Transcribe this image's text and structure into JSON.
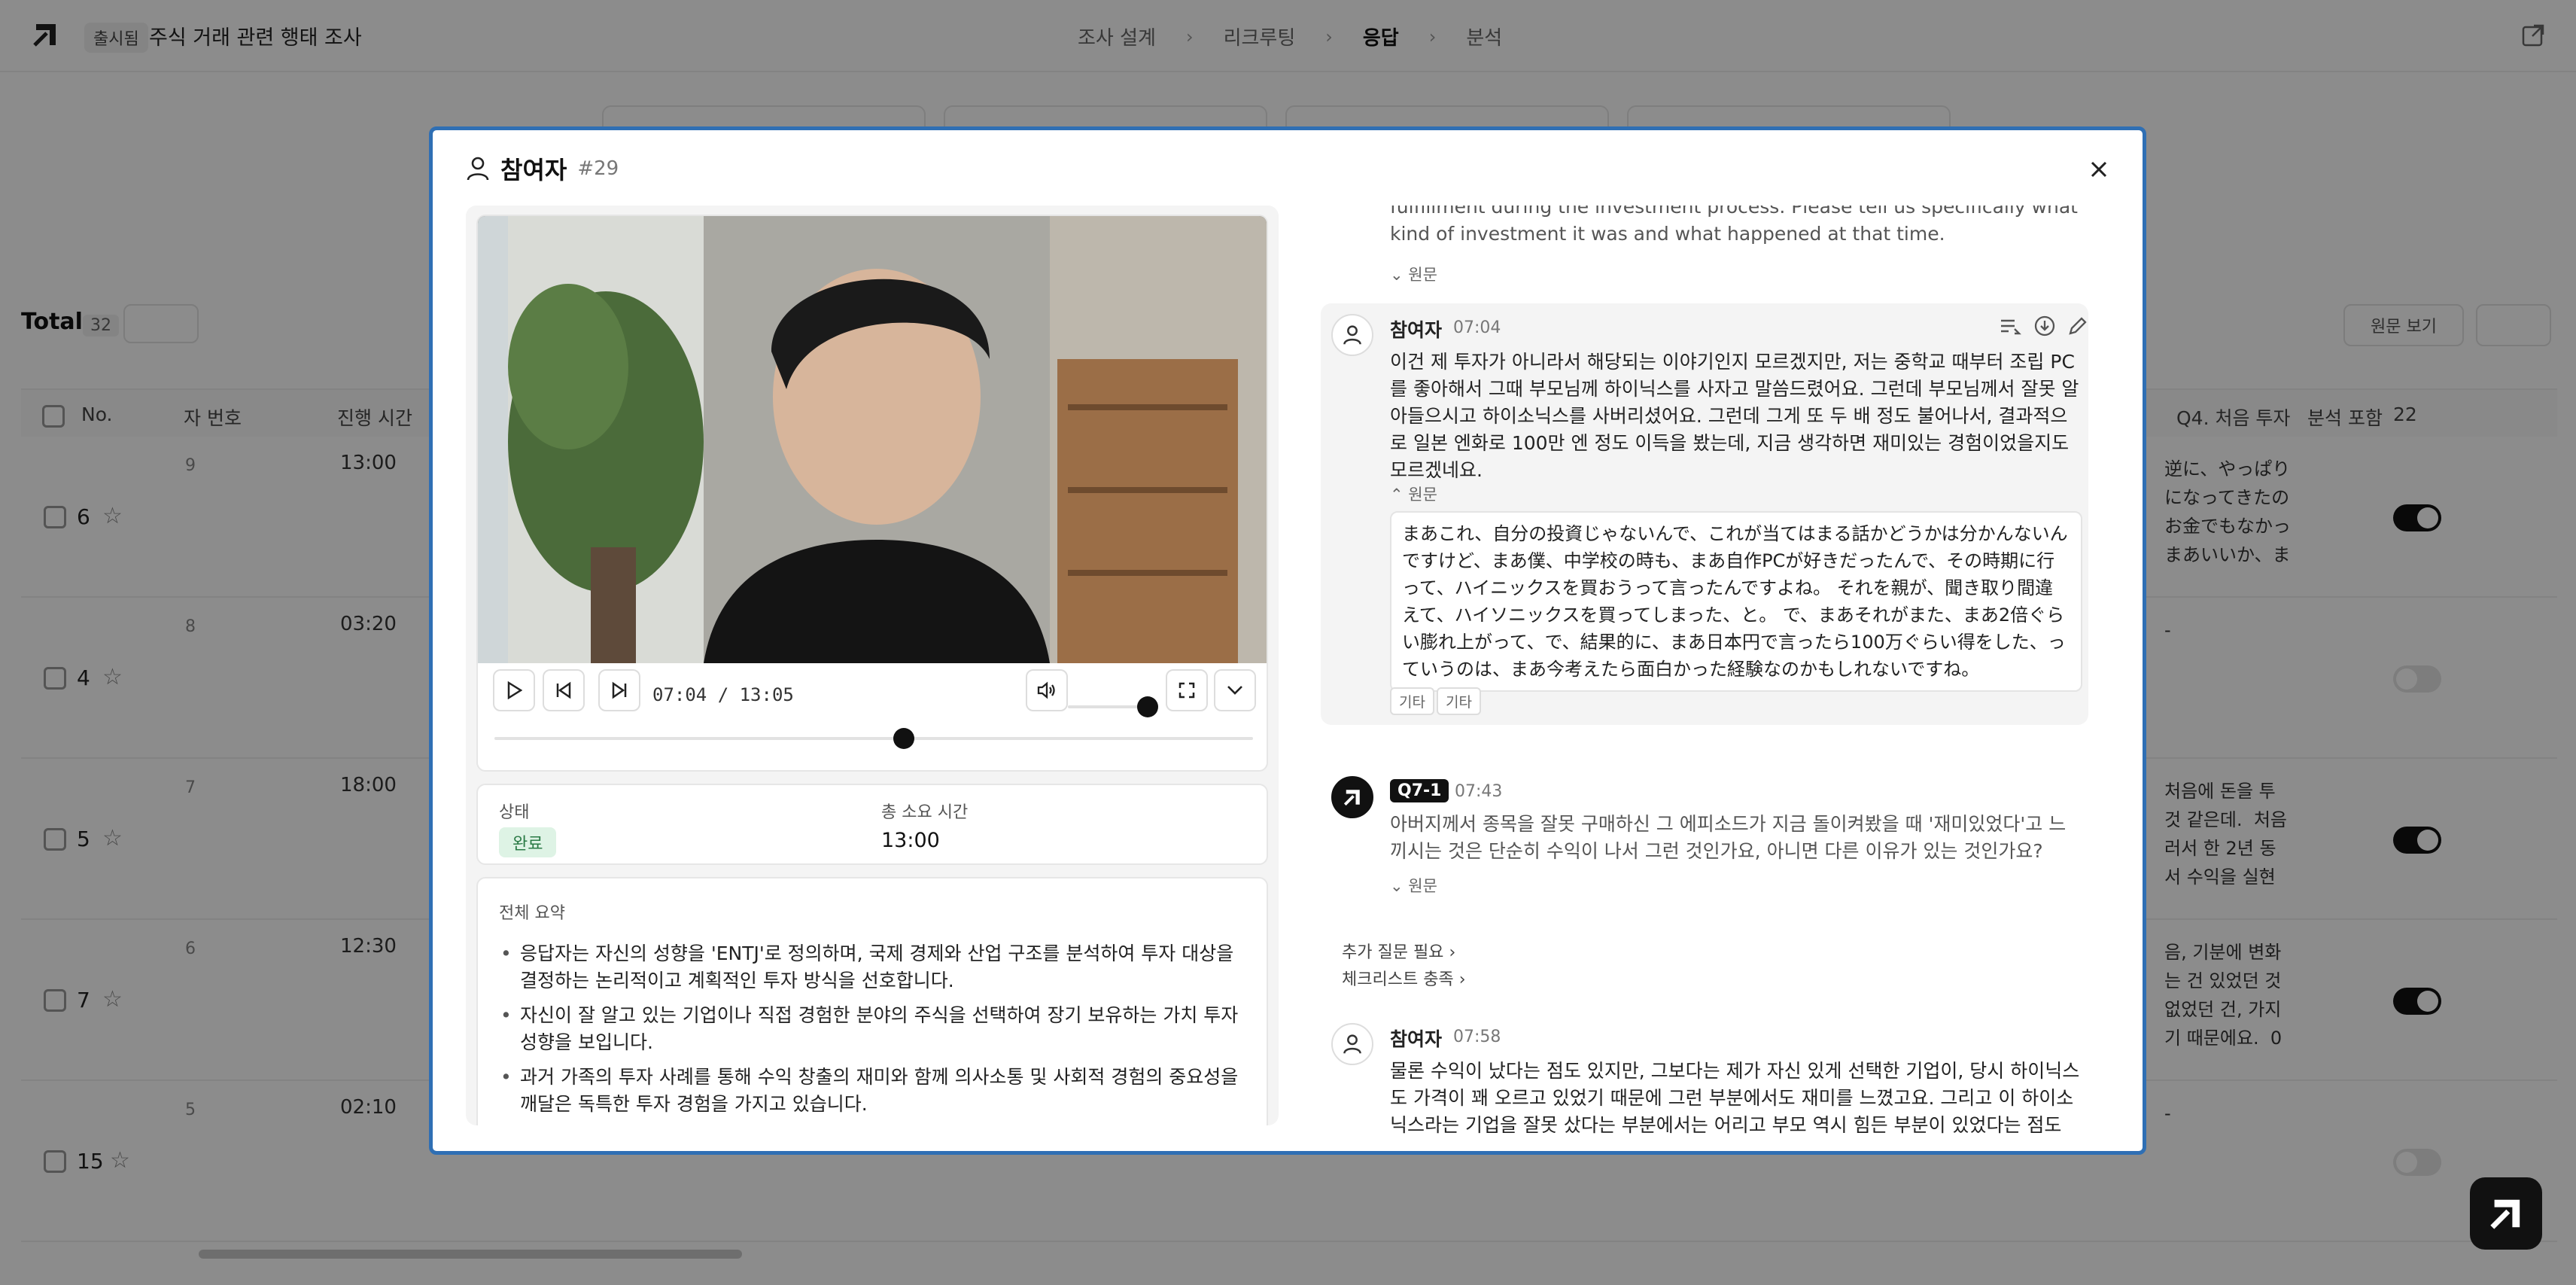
{
  "app": {
    "launch_badge": "출시됨",
    "project_title": "주식 거래 관련 행태 조사",
    "steps": [
      "조사 설계",
      "리크루팅",
      "응답",
      "분석"
    ],
    "active_step": "응답"
  },
  "list": {
    "total_label": "Total",
    "total_count": "32",
    "view_label": "원문 보기",
    "columns": {
      "no": "No.",
      "participant_no": "자 번호",
      "duration": "진행 시간",
      "q4": "Q4. 처음 투자",
      "include_analysis": "분석 포함",
      "include_count": "22"
    },
    "rows": [
      {
        "no": "6",
        "pid": "9",
        "duration": "13:00",
        "snippet": "逆に、やっぱり\nになってきたの\nお金でもなかっ\nまあいいか、ま",
        "included": true
      },
      {
        "no": "4",
        "pid": "8",
        "duration": "03:20",
        "snippet": "-",
        "included": false
      },
      {
        "no": "5",
        "pid": "7",
        "duration": "18:00",
        "snippet": "처음에 돈을 투\n것 같은데.  처음\n러서 한 2년 동\n서 수익을 실현",
        "included": true
      },
      {
        "no": "7",
        "pid": "6",
        "duration": "12:30",
        "snippet": "음, 기분에 변화\n는 건 있었던 것\n없었던 건, 가지\n기 때문에요.  0",
        "included": true
      },
      {
        "no": "15",
        "pid": "5",
        "duration": "02:10",
        "snippet": "-",
        "included": false
      }
    ]
  },
  "modal": {
    "title": "참여자",
    "participant_id": "#29",
    "player": {
      "time": "07:04 / 13:05",
      "seek_fraction": 0.54,
      "volume_fraction": 1.0
    },
    "status": {
      "state_label": "상태",
      "state_value": "완료",
      "duration_label": "총 소요 시간",
      "duration_value": "13:00"
    },
    "summary": {
      "title": "전체 요약",
      "items": [
        "응답자는 자신의 성향을 'ENTJ'로 정의하며, 국제 경제와 산업 구조를 분석하여 투자 대상을 결정하는 논리적이고 계획적인 투자 방식을 선호합니다.",
        "자신이 잘 알고 있는 기업이나 직접 경험한 분야의 주식을 선택하여 장기 보유하는 가치 투자 성향을 보입니다.",
        "과거 가족의 투자 사례를 통해 수익 창출의 재미와 함께 의사소통 및 사회적 경험의 중요성을 깨달은 독특한 투자 경험을 가지고 있습니다."
      ]
    },
    "transcript": {
      "prev_question_tail": "fulfillment during the investment process. Please tell us specifically what kind of investment it was and what happened at that time.",
      "original_label": "원문",
      "answer1": {
        "speaker": "참여자",
        "time": "07:04",
        "text": "이건 제 투자가 아니라서 해당되는 이야기인지 모르겠지만, 저는 중학교 때부터 조립 PC를 좋아해서 그때 부모님께 하이닉스를 사자고 말씀드렸어요. 그런데 부모님께서 잘못 알아들으시고 하이소닉스를 사버리셨어요. 그런데 그게 또 두 배 정도 불어나서, 결과적으로 일본 엔화로 100만 엔 정도 이득을 봤는데, 지금 생각하면 재미있는 경험이었을지도 모르겠네요.",
        "original": "まあこれ、自分の投資じゃないんで、これが当てはまる話かどうかは分かんないんですけど、まあ僕、中学校の時も、まあ自作PCが好きだったんで、その時期に行って、ハイニックスを買おうって言ったんですよね。 それを親が、聞き取り間違えて、ハイソニックスを買ってしまった、と。 で、まあそれがまた、まあ2倍ぐらい膨れ上がって、で、結果的に、まあ日本円で言ったら100万ぐらい得をした、っていうのは、まあ今考えたら面白かった経験なのかもしれないですね。",
        "tags": [
          "기타",
          "기타"
        ]
      },
      "question": {
        "badge": "Q7-1",
        "time": "07:43",
        "text": "아버지께서 종목을 잘못 구매하신 그 에피소드가 지금 돌이켜봤을 때 '재미있었다'고 느끼시는 것은 단순히 수익이 나서 그런 것인가요, 아니면 다른 이유가 있는 것인가요?"
      },
      "links": [
        "추가 질문 필요",
        "체크리스트 충족"
      ],
      "answer2": {
        "speaker": "참여자",
        "time": "07:58",
        "text": "물론 수익이 났다는 점도 있지만, 그보다는 제가 자신 있게 선택한 기업이, 당시 하이닉스도 가격이 꽤 오르고 있었기 때문에 그런 부분에서도 재미를 느꼈고요. 그리고 이 하이소닉스라는 기업을 잘못 샀다는 부분에서는 어리고 부모 역시 힘든 부분이 있었다는 점도 있고요."
      }
    }
  }
}
